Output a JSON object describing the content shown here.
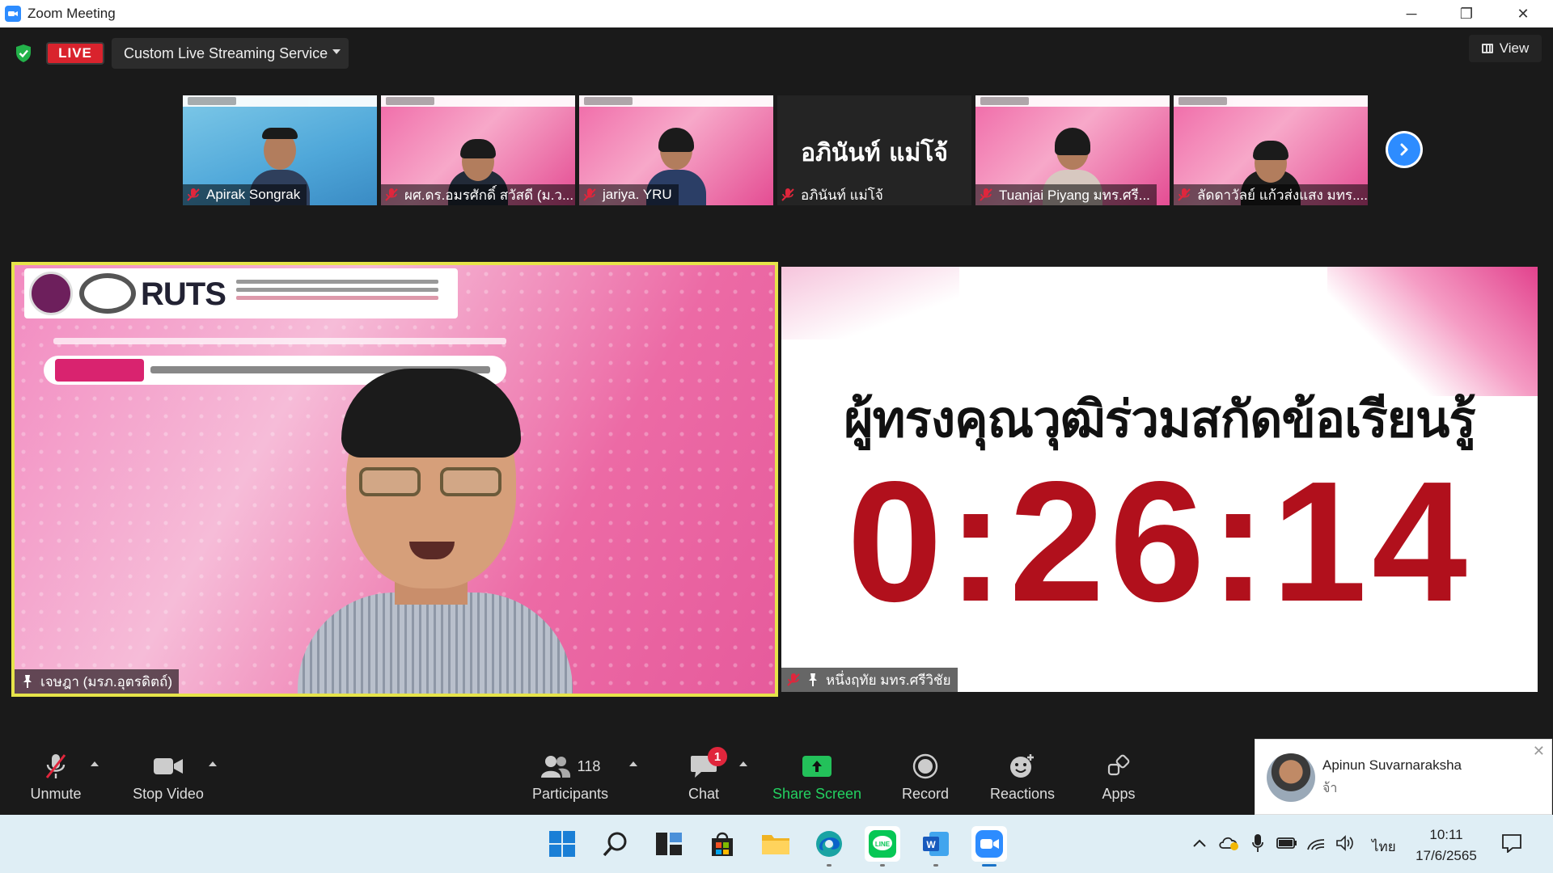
{
  "window": {
    "title": "Zoom Meeting",
    "minimize": "─",
    "restore": "❐",
    "close": "✕"
  },
  "topbar": {
    "live_label": "LIVE",
    "stream_service": "Custom Live Streaming Service",
    "view_label": "View"
  },
  "thumbnails": [
    {
      "name": "Apirak Songrak",
      "muted": true
    },
    {
      "name": "ผศ.ดร.อมรศักดิ์ สวัสดี (ม.ว...",
      "muted": true
    },
    {
      "name": "jariya. YRU",
      "muted": true
    },
    {
      "name": "อภินันท์ แม่โจ้",
      "muted": true,
      "display_name": "อภินันท์ แม่โจ้"
    },
    {
      "name": "Tuanjai  Piyang มทร.ศรี...",
      "muted": true
    },
    {
      "name": "ลัดดาวัลย์ แก้วส่งแสง มทร....",
      "muted": true
    }
  ],
  "main_left": {
    "label": "เจษฎา (มรภ.อุตรดิตถ์)",
    "logo_text": "RUTS"
  },
  "main_right": {
    "label": "หนึ่งฤทัย มทร.ศรีวิชัย",
    "heading": "ผู้ทรงคุณวุฒิร่วมสกัดข้อเรียนรู้",
    "timer": "0:26:14"
  },
  "toolbar": {
    "unmute": "Unmute",
    "stop_video": "Stop Video",
    "participants": "Participants",
    "participant_count": "118",
    "chat": "Chat",
    "chat_badge": "1",
    "share_screen": "Share Screen",
    "record": "Record",
    "reactions": "Reactions",
    "apps": "Apps"
  },
  "chat_popup": {
    "sender": "Apinun Suvarnaraksha",
    "message": "จ้า"
  },
  "taskbar": {
    "language": "ไทย",
    "time": "10:11",
    "date": "17/6/2565"
  },
  "colors": {
    "live_red": "#d9232d",
    "zoom_blue": "#2d8cff",
    "share_green": "#23c15a",
    "timer_red": "#b1101c",
    "active_speaker": "#e6e44a"
  }
}
